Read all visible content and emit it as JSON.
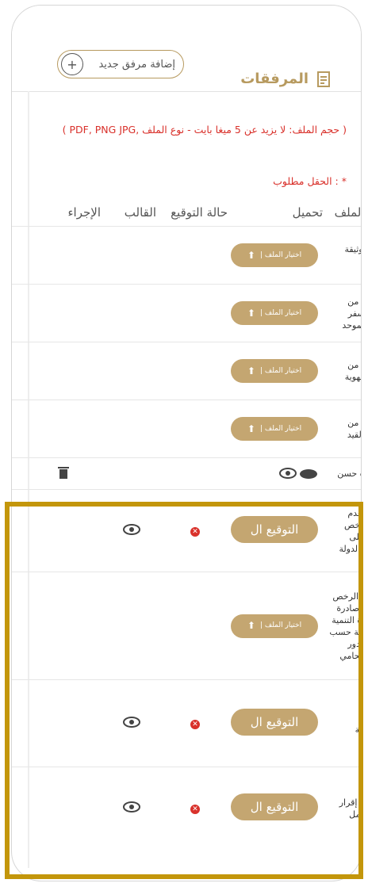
{
  "section": {
    "title": "المرفقات",
    "add_button": "إضافة مرفق جديد",
    "add_icon": "plus-icon"
  },
  "info": {
    "note": "( حجم الملف: لا يزيد عن 5 ميغا بايت - نوع الملف ,PDF, PNG JPG )",
    "required": "* : الحقل مطلوب"
  },
  "table": {
    "headers": [
      "اسم الملف",
      "تحميل",
      "حالة التوقيع",
      "القالب",
      "الإجراء"
    ],
    "choose_label": "اختيار الملف |",
    "sign_label": "التوقيع ال",
    "rows": [
      {
        "name": "تعبئة وثيقة تعارف"
      },
      {
        "name": "صورة من جواز السفر الرقم الموحد"
      },
      {
        "name": "صورة من بطاقة الهوية"
      },
      {
        "name": "صورة من خلاصة القيد"
      },
      {
        "name": "شهادة حسن"
      },
      {
        "name": "تعهد بعدم امتلاك رخص تجارية على مستوى الدولة"
      },
      {
        "name": "كشف الرخص التجارية صادرة من دائرة التنمية الاقتصادية حسب مكان صدور جواز المحامي"
      },
      {
        "name": "التعهد بالاستقالة"
      },
      {
        "name": "تعهد و إقرار بعدم العمل"
      }
    ]
  },
  "colors": {
    "gold": "#c4a671",
    "red": "#d9312b",
    "highlight": "#c3960b"
  }
}
